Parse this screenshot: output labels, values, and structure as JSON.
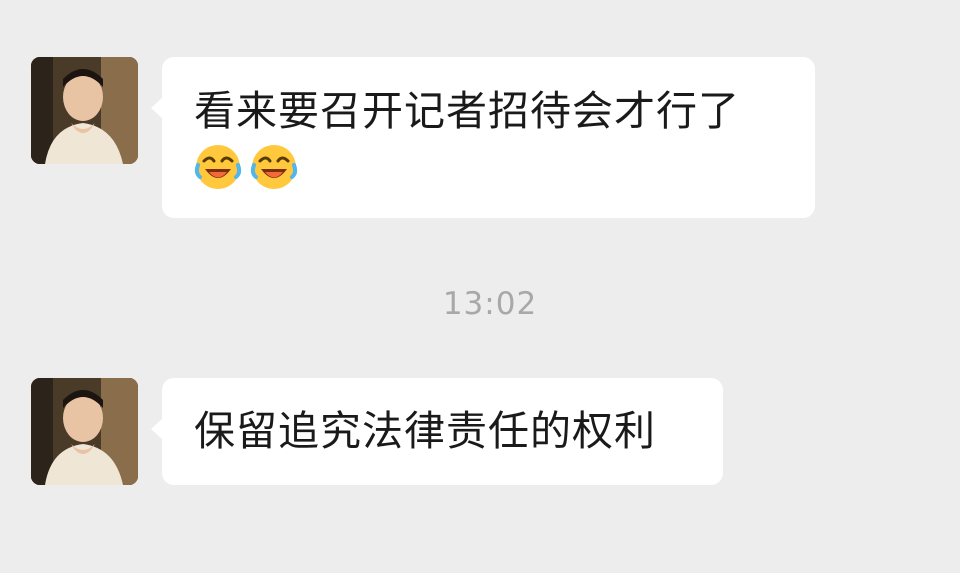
{
  "conversation": {
    "messages": [
      {
        "sender": "contact",
        "text": "看来要召开记者招待会才行了",
        "emojis": [
          "laughing-crying-face",
          "laughing-crying-face"
        ]
      },
      {
        "sender": "contact",
        "text": "保留追究法律责任的权利",
        "emojis": []
      }
    ],
    "timestamp": "13:02"
  },
  "colors": {
    "background": "#ededed",
    "bubble": "#ffffff",
    "text": "#1a1a1a",
    "timestamp": "#a8a8a8"
  }
}
